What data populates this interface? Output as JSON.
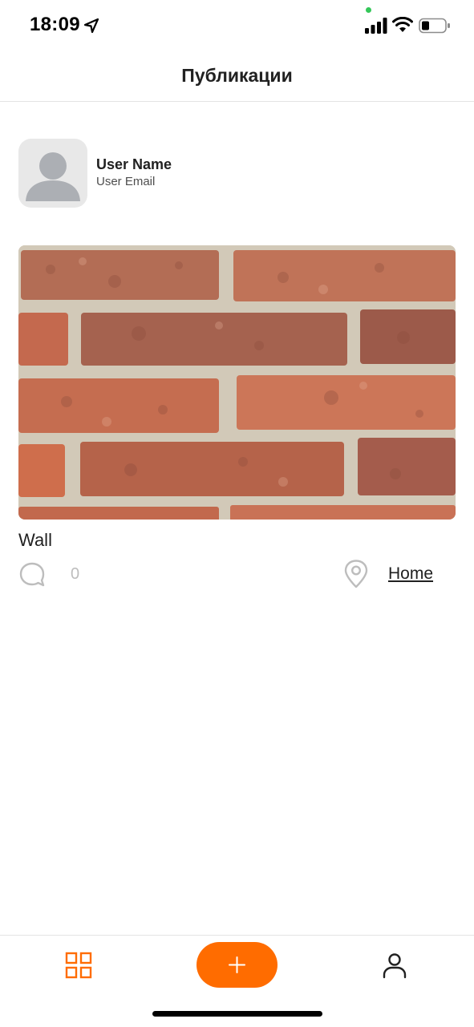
{
  "status_bar": {
    "time": "18:09",
    "icons": [
      "location-arrow-icon",
      "signal-icon",
      "wifi-icon",
      "battery-icon"
    ]
  },
  "header": {
    "title": "Публикации"
  },
  "profile": {
    "name": "User Name",
    "email": "User Email",
    "avatar_icon": "user-placeholder-icon"
  },
  "post": {
    "image_description_icon": "brick-wall-photo",
    "title": "Wall",
    "comments_icon": "comment-icon",
    "comments_count": "0",
    "location_icon": "map-pin-icon",
    "location": "Home"
  },
  "tabbar": {
    "items": [
      "grid-icon",
      "plus-icon",
      "user-icon"
    ]
  },
  "colors": {
    "accent": "#ff6c00",
    "text": "#212121",
    "muted": "#bdbdbd",
    "divider": "#e3e3e3",
    "avatar_bg": "#e8e8e8"
  }
}
